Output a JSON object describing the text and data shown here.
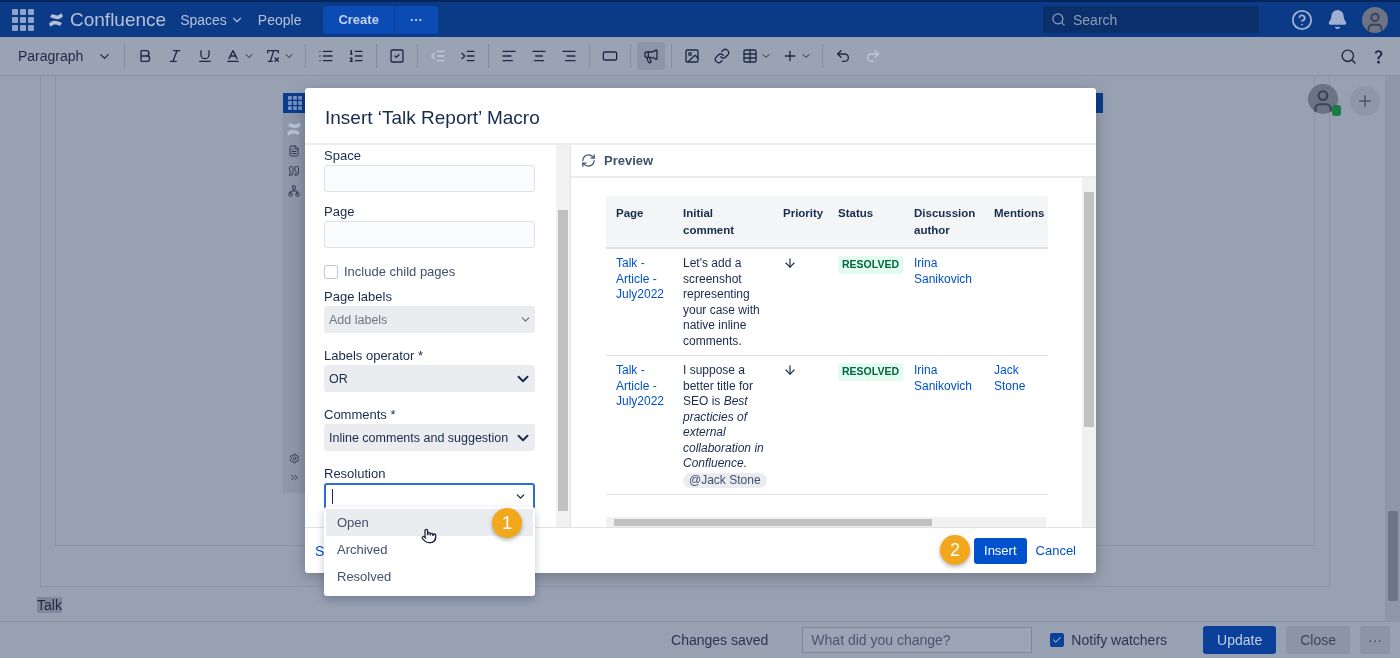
{
  "topnav": {
    "product": "Confluence",
    "links": [
      {
        "label": "Spaces",
        "dropdown": true
      },
      {
        "label": "People",
        "dropdown": false
      }
    ],
    "create": "Create",
    "more": "···",
    "search": {
      "placeholder": "Search"
    }
  },
  "toolbar": {
    "style": "Paragraph",
    "tools": [
      {
        "kind": "bold",
        "selected": false,
        "disabled": false
      },
      {
        "kind": "italic",
        "selected": false,
        "disabled": false
      },
      {
        "kind": "underline",
        "selected": false,
        "disabled": false
      },
      {
        "kind": "color",
        "selected": false,
        "disabled": false
      },
      {
        "kind": "clear",
        "selected": false,
        "disabled": false
      },
      {
        "kind": "bullets",
        "selected": false,
        "disabled": false
      },
      {
        "kind": "numbers",
        "selected": false,
        "disabled": false
      },
      {
        "kind": "task",
        "selected": false,
        "disabled": false
      },
      {
        "kind": "outdent",
        "selected": false,
        "disabled": true
      },
      {
        "kind": "indent",
        "selected": false,
        "disabled": false
      },
      {
        "kind": "left",
        "selected": false,
        "disabled": false
      },
      {
        "kind": "center",
        "selected": false,
        "disabled": false
      },
      {
        "kind": "right",
        "selected": false,
        "disabled": false
      },
      {
        "kind": "layout",
        "selected": false,
        "disabled": false
      },
      {
        "kind": "megaphone",
        "selected": true,
        "disabled": false
      },
      {
        "kind": "image",
        "selected": false,
        "disabled": false
      },
      {
        "kind": "link",
        "selected": false,
        "disabled": false
      },
      {
        "kind": "table",
        "selected": false,
        "disabled": false
      },
      {
        "kind": "insert",
        "selected": false,
        "disabled": false
      },
      {
        "kind": "undo",
        "selected": false,
        "disabled": false
      },
      {
        "kind": "redo",
        "selected": false,
        "disabled": true
      }
    ]
  },
  "editor": {
    "text": "Talk"
  },
  "dialog": {
    "title": "Insert ‘Talk Report’ Macro",
    "fields": [
      {
        "kind": "input",
        "label": "Space"
      },
      {
        "kind": "input",
        "label": "Page"
      },
      {
        "kind": "checkbox",
        "label": "Include child pages",
        "checked": false
      },
      {
        "kind": "select",
        "label": "Page labels",
        "placeholder": "Add labels"
      },
      {
        "kind": "select",
        "label": "Labels operator *",
        "value": "OR"
      },
      {
        "kind": "select",
        "label": "Comments *",
        "value": "Inline comments and suggestion"
      },
      {
        "kind": "combo",
        "label": "Resolution",
        "focused": true
      }
    ],
    "options": [
      {
        "label": "Open",
        "selected": true
      },
      {
        "label": "Archived",
        "selected": false
      },
      {
        "label": "Resolved",
        "selected": false
      }
    ],
    "preview": {
      "title": "Preview",
      "columns": [
        "Page",
        "Initial comment",
        "Priority",
        "Status",
        "Discussion author",
        "Mentions"
      ],
      "rows": [
        {
          "page": "Talk - Article - July2022",
          "comment": "Let's add a screenshot representing your case with native inline comments.",
          "status": "RESOLVED",
          "author": "Irina Sanikovich"
        },
        {
          "page": "Talk - Article - July2022",
          "comment": "I suppose a better title for SEO is *Best practicies of external collaboration in Confluence.*",
          "chip": "@Jack Stone",
          "status": "RESOLVED",
          "author": "Irina Sanikovich",
          "mentions": "Jack Stone"
        }
      ]
    },
    "footer": {
      "link": "S",
      "insert": "Insert",
      "cancel": "Cancel"
    },
    "steps": [
      "1",
      "2"
    ]
  },
  "bottombar": {
    "status": "Changes saved",
    "comment_placeholder": "What did you change?",
    "notify": {
      "label": "Notify watchers",
      "checked": true
    },
    "update": "Update",
    "close": "Close",
    "more": "···"
  }
}
